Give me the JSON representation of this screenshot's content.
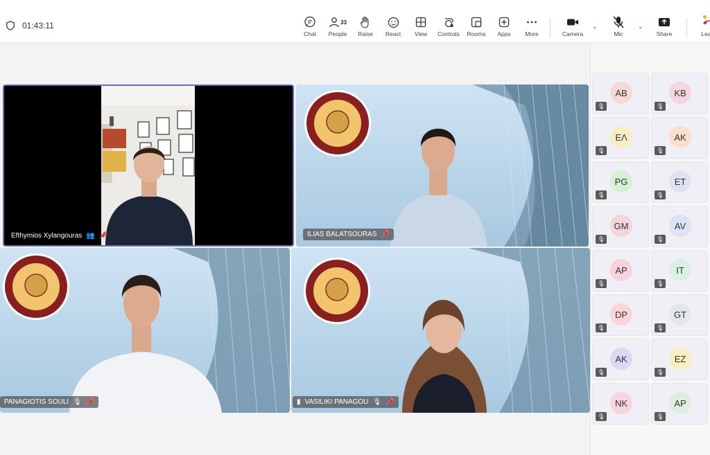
{
  "meeting": {
    "timer": "01:43:11"
  },
  "toolbar": {
    "chat": "Chat",
    "people": "People",
    "people_count": "33",
    "raise": "Raise",
    "react": "React",
    "view": "View",
    "controls": "Controls",
    "rooms": "Rooms",
    "apps": "Apps",
    "more": "More",
    "camera": "Camera",
    "mic": "Mic",
    "share": "Share",
    "leave": "Leave"
  },
  "colors": {
    "leave_red": "#c4314b",
    "active_border": "#6b68c7",
    "notif": "#f2b400"
  },
  "videos": [
    {
      "name": "Efthymios Xylangouras"
    },
    {
      "name": "ILIAS BALATSOURAS"
    },
    {
      "name": "PANAGIOTIS SOULI"
    },
    {
      "name": "VASILIKI PANAGOU"
    }
  ],
  "roster": [
    {
      "initials": "AB",
      "color": "#f6d9d3"
    },
    {
      "initials": "KB",
      "color": "#f4d5e0"
    },
    {
      "initials": "ΕΛ",
      "color": "#f8eec2"
    },
    {
      "initials": "AK",
      "color": "#f9e0cc"
    },
    {
      "initials": "PG",
      "color": "#d6f0d4"
    },
    {
      "initials": "ET",
      "color": "#dfe3f1"
    },
    {
      "initials": "GM",
      "color": "#f2d6dc"
    },
    {
      "initials": "AV",
      "color": "#dbe3f6"
    },
    {
      "initials": "AP",
      "color": "#f7d4dc"
    },
    {
      "initials": "IT",
      "color": "#d9f1e3"
    },
    {
      "initials": "DP",
      "color": "#f9d6d6"
    },
    {
      "initials": "GT",
      "color": "#e3e6ec"
    },
    {
      "initials": "AK",
      "color": "#dad8f3"
    },
    {
      "initials": "EZ",
      "color": "#f8efc0"
    },
    {
      "initials": "NK",
      "color": "#f6d5df"
    },
    {
      "initials": "AP",
      "color": "#dfeedd"
    }
  ]
}
